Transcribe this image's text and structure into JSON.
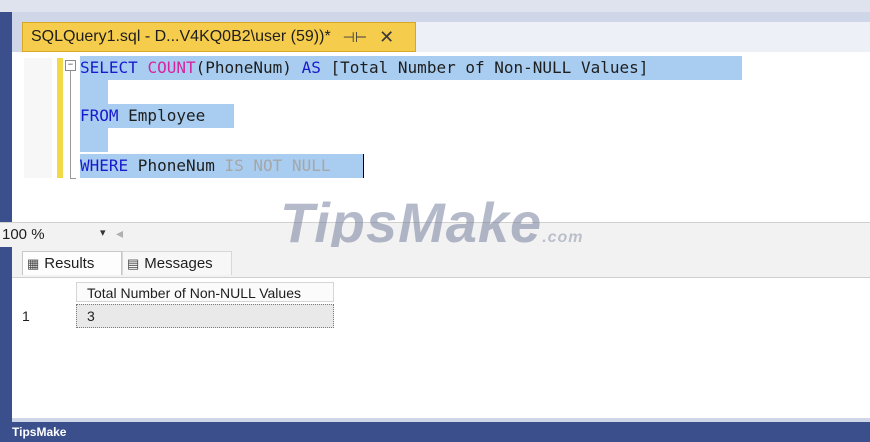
{
  "tab": {
    "title": "SQLQuery1.sql - D...V4KQ0B2\\user (59))*",
    "pin_icon": "⊣⊢",
    "close_icon": "✕"
  },
  "editor": {
    "collapse_icon": "−",
    "line1": {
      "kw1": "SELECT",
      "fn": "COUNT",
      "p1": "(PhoneNum)",
      "kw2": "AS",
      "rest": "[Total Number of Non-NULL Values]"
    },
    "line2": {
      "kw": "FROM",
      "rest": " Employee"
    },
    "line3": {
      "kw": "WHERE",
      "col": " PhoneNum ",
      "tail": "IS NOT NULL"
    }
  },
  "zoom": {
    "value": "100 %",
    "arrow": "▾",
    "scroll": "◂"
  },
  "results_tabs": [
    {
      "icon": "▦",
      "label": "Results"
    },
    {
      "icon": "▤",
      "label": "Messages"
    }
  ],
  "grid": {
    "columns": [
      "Total Number of Non-NULL Values"
    ],
    "rows": [
      {
        "num": "1",
        "values": [
          "3"
        ]
      }
    ]
  },
  "watermark": {
    "text": "TipsMake",
    "suffix": ".com"
  },
  "footer": {
    "text": "TipsMake"
  }
}
